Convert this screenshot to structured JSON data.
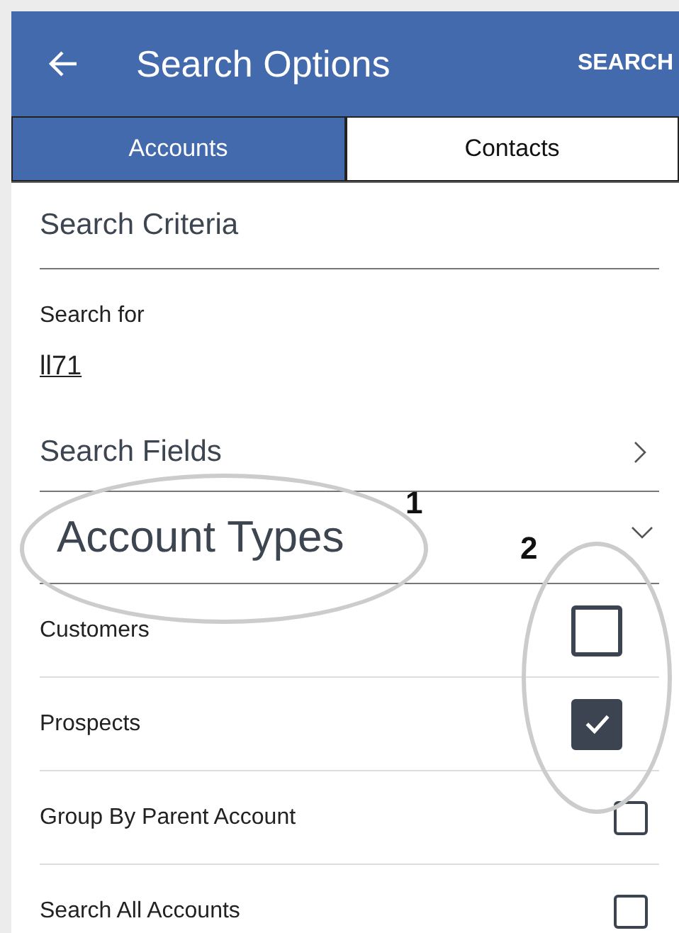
{
  "header": {
    "title": "Search Options",
    "action": "SEARCH"
  },
  "tabs": [
    {
      "label": "Accounts",
      "selected": true
    },
    {
      "label": "Contacts",
      "selected": false
    }
  ],
  "search_criteria": {
    "heading": "Search Criteria",
    "label": "Search for",
    "value": "ll71"
  },
  "search_fields": {
    "label": "Search Fields"
  },
  "account_types": {
    "heading": "Account Types",
    "expanded": true,
    "options": [
      {
        "label": "Customers",
        "checked": false,
        "magnified": true
      },
      {
        "label": "Prospects",
        "checked": true,
        "magnified": true
      },
      {
        "label": "Group By Parent Account",
        "checked": false,
        "magnified": false
      },
      {
        "label": "Search All Accounts",
        "checked": false,
        "magnified": false
      }
    ]
  },
  "callouts": [
    {
      "label": "1"
    },
    {
      "label": "2"
    }
  ]
}
